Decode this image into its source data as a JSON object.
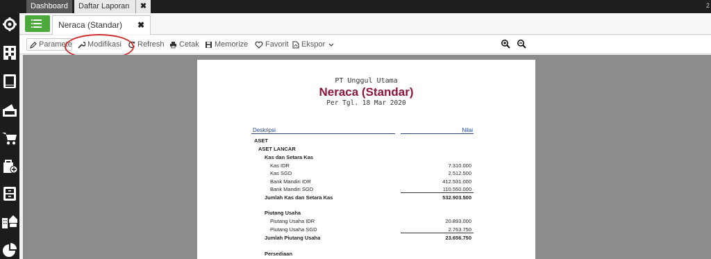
{
  "top_tabs": {
    "dashboard": "Dashboard",
    "daftar_laporan": "Daftar Laporan",
    "close_symbol": "✖",
    "corner_text": "2"
  },
  "sub_tab": {
    "label": "Neraca (Standar)",
    "close_symbol": "✖"
  },
  "toolbar": {
    "parameter": "Parameter",
    "modifikasi": "Modifikasi",
    "refresh": "Refresh",
    "cetak": "Cetak",
    "memorize": "Memorize",
    "favorit": "Favorit",
    "ekspor": "Ekspor"
  },
  "sidebar_icons": [
    "gear-icon",
    "building-icon",
    "book-icon",
    "wallet-icon",
    "cart-icon",
    "bag-add-icon",
    "cabinet-icon",
    "city-icon",
    "pie-chart-icon"
  ],
  "report": {
    "company": "PT Unggul Utama",
    "title": "Neraca (Standar)",
    "date": "Per Tgl. 18 Mar 2020",
    "col_desc": "Deskripsi",
    "col_value": "Nilai",
    "sections": {
      "aset": "ASET",
      "aset_lancar": "ASET LANCAR",
      "kas_group": "Kas dan Setara Kas",
      "kas_idr": {
        "label": "Kas IDR",
        "value": "7.310.000"
      },
      "kas_sgd": {
        "label": "Kas SGD",
        "value": "2.512.500"
      },
      "bank_idr": {
        "label": "Bank Mandiri IDR",
        "value": "412.531.000"
      },
      "bank_sgd": {
        "label": "Bank Mandiri SGD",
        "value": "110.550.000"
      },
      "jumlah_kas": {
        "label": "Jumlah Kas dan Setara Kas",
        "value": "532.903.500"
      },
      "piutang_group": "Piutang Usaha",
      "piutang_idr": {
        "label": "Piutang Usaha IDR",
        "value": "20.893.000"
      },
      "piutang_sgd": {
        "label": "Piutang Usaha SGD",
        "value": "2.763.750"
      },
      "jumlah_piutang": {
        "label": "Jumlah Piutang Usaha",
        "value": "23.656.750"
      },
      "persediaan": "Persediaan"
    }
  },
  "colors": {
    "accent_green": "#4caa3c",
    "title_red": "#8a1538",
    "header_blue": "#1f3f8f",
    "annotation_red": "#d32a2a"
  }
}
